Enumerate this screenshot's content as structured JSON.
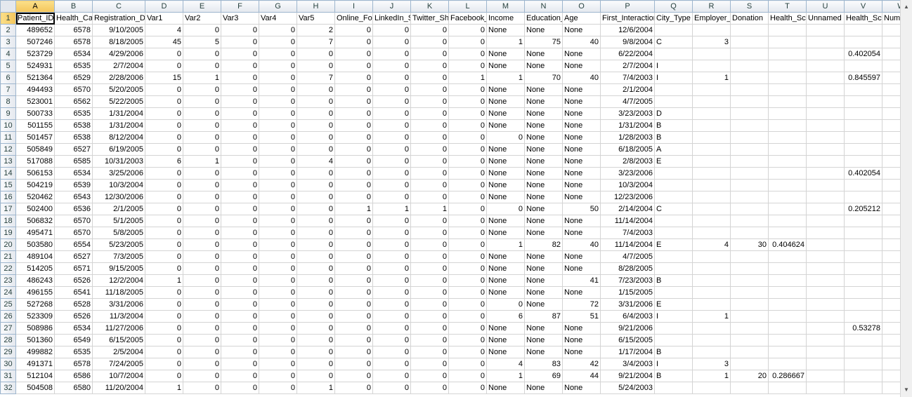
{
  "columns": [
    "A",
    "B",
    "C",
    "D",
    "E",
    "F",
    "G",
    "H",
    "I",
    "J",
    "K",
    "L",
    "M",
    "N",
    "O",
    "P",
    "Q",
    "R",
    "S",
    "T",
    "U",
    "V",
    "W"
  ],
  "header_row": [
    "Patient_ID",
    "Health_Camp_ID",
    "Registration_Date",
    "Var1",
    "Var2",
    "Var3",
    "Var4",
    "Var5",
    "Online_Follower",
    "LinkedIn_Shared",
    "Twitter_Shared",
    "Facebook_Shared",
    "Income",
    "Education_Score",
    "Age",
    "First_Interaction",
    "City_Type",
    "Employer_Category",
    "Donation",
    "Health_Score",
    "Unnamed",
    "Health_Score",
    "Number_of_stall_visited"
  ],
  "rows": [
    [
      "489652",
      "6578",
      "9/10/2005",
      "4",
      "0",
      "0",
      "0",
      "2",
      "0",
      "0",
      "0",
      "0",
      "None",
      "None",
      "None",
      "12/6/2004",
      "",
      "",
      "",
      "",
      "",
      "",
      ""
    ],
    [
      "507246",
      "6578",
      "8/18/2005",
      "45",
      "5",
      "0",
      "0",
      "7",
      "0",
      "0",
      "0",
      "0",
      "1",
      "75",
      "40",
      "9/8/2004",
      "C",
      "3",
      "",
      "",
      "",
      "",
      ""
    ],
    [
      "523729",
      "6534",
      "4/29/2006",
      "0",
      "0",
      "0",
      "0",
      "0",
      "0",
      "0",
      "0",
      "0",
      "None",
      "None",
      "None",
      "6/22/2004",
      "",
      "",
      "",
      "",
      "",
      "0.402054",
      ""
    ],
    [
      "524931",
      "6535",
      "2/7/2004",
      "0",
      "0",
      "0",
      "0",
      "0",
      "0",
      "0",
      "0",
      "0",
      "None",
      "None",
      "None",
      "2/7/2004",
      "I",
      "",
      "",
      "",
      "",
      "",
      ""
    ],
    [
      "521364",
      "6529",
      "2/28/2006",
      "15",
      "1",
      "0",
      "0",
      "7",
      "0",
      "0",
      "0",
      "1",
      "1",
      "70",
      "40",
      "7/4/2003",
      "I",
      "1",
      "",
      "",
      "",
      "0.845597",
      ""
    ],
    [
      "494493",
      "6570",
      "5/20/2005",
      "0",
      "0",
      "0",
      "0",
      "0",
      "0",
      "0",
      "0",
      "0",
      "None",
      "None",
      "None",
      "2/1/2004",
      "",
      "",
      "",
      "",
      "",
      "",
      ""
    ],
    [
      "523001",
      "6562",
      "5/22/2005",
      "0",
      "0",
      "0",
      "0",
      "0",
      "0",
      "0",
      "0",
      "0",
      "None",
      "None",
      "None",
      "4/7/2005",
      "",
      "",
      "",
      "",
      "",
      "",
      ""
    ],
    [
      "500733",
      "6535",
      "1/31/2004",
      "0",
      "0",
      "0",
      "0",
      "0",
      "0",
      "0",
      "0",
      "0",
      "None",
      "None",
      "None",
      "3/23/2003",
      "D",
      "",
      "",
      "",
      "",
      "",
      ""
    ],
    [
      "501155",
      "6538",
      "1/31/2004",
      "0",
      "0",
      "0",
      "0",
      "0",
      "0",
      "0",
      "0",
      "0",
      "None",
      "None",
      "None",
      "1/31/2004",
      "B",
      "",
      "",
      "",
      "",
      "",
      ""
    ],
    [
      "501457",
      "6538",
      "8/12/2004",
      "0",
      "0",
      "0",
      "0",
      "0",
      "0",
      "0",
      "0",
      "0",
      "0",
      "None",
      "None",
      "1/28/2003",
      "B",
      "",
      "",
      "",
      "",
      "",
      ""
    ],
    [
      "505849",
      "6527",
      "6/19/2005",
      "0",
      "0",
      "0",
      "0",
      "0",
      "0",
      "0",
      "0",
      "0",
      "None",
      "None",
      "None",
      "6/18/2005",
      "A",
      "",
      "",
      "",
      "",
      "",
      ""
    ],
    [
      "517088",
      "6585",
      "10/31/2003",
      "6",
      "1",
      "0",
      "0",
      "4",
      "0",
      "0",
      "0",
      "0",
      "None",
      "None",
      "None",
      "2/8/2003",
      "E",
      "",
      "",
      "",
      "",
      "",
      ""
    ],
    [
      "506153",
      "6534",
      "3/25/2006",
      "0",
      "0",
      "0",
      "0",
      "0",
      "0",
      "0",
      "0",
      "0",
      "None",
      "None",
      "None",
      "3/23/2006",
      "",
      "",
      "",
      "",
      "",
      "0.402054",
      ""
    ],
    [
      "504219",
      "6539",
      "10/3/2004",
      "0",
      "0",
      "0",
      "0",
      "0",
      "0",
      "0",
      "0",
      "0",
      "None",
      "None",
      "None",
      "10/3/2004",
      "",
      "",
      "",
      "",
      "",
      "",
      ""
    ],
    [
      "520462",
      "6543",
      "12/30/2006",
      "0",
      "0",
      "0",
      "0",
      "0",
      "0",
      "0",
      "0",
      "0",
      "None",
      "None",
      "None",
      "12/23/2006",
      "",
      "",
      "",
      "",
      "",
      "",
      ""
    ],
    [
      "502400",
      "6536",
      "2/1/2005",
      "0",
      "0",
      "0",
      "0",
      "0",
      "1",
      "1",
      "1",
      "0",
      "0",
      "None",
      "50",
      "2/14/2004",
      "C",
      "",
      "",
      "",
      "",
      "0.205212",
      ""
    ],
    [
      "506832",
      "6570",
      "5/1/2005",
      "0",
      "0",
      "0",
      "0",
      "0",
      "0",
      "0",
      "0",
      "0",
      "None",
      "None",
      "None",
      "11/14/2004",
      "",
      "",
      "",
      "",
      "",
      "",
      ""
    ],
    [
      "495471",
      "6570",
      "5/8/2005",
      "0",
      "0",
      "0",
      "0",
      "0",
      "0",
      "0",
      "0",
      "0",
      "None",
      "None",
      "None",
      "7/4/2003",
      "",
      "",
      "",
      "",
      "",
      "",
      ""
    ],
    [
      "503580",
      "6554",
      "5/23/2005",
      "0",
      "0",
      "0",
      "0",
      "0",
      "0",
      "0",
      "0",
      "0",
      "1",
      "82",
      "40",
      "11/14/2004",
      "E",
      "4",
      "30",
      "0.404624",
      "",
      "",
      ""
    ],
    [
      "489104",
      "6527",
      "7/3/2005",
      "0",
      "0",
      "0",
      "0",
      "0",
      "0",
      "0",
      "0",
      "0",
      "None",
      "None",
      "None",
      "4/7/2005",
      "",
      "",
      "",
      "",
      "",
      "",
      ""
    ],
    [
      "514205",
      "6571",
      "9/15/2005",
      "0",
      "0",
      "0",
      "0",
      "0",
      "0",
      "0",
      "0",
      "0",
      "None",
      "None",
      "None",
      "8/28/2005",
      "",
      "",
      "",
      "",
      "",
      "",
      ""
    ],
    [
      "486243",
      "6526",
      "12/2/2004",
      "1",
      "0",
      "0",
      "0",
      "0",
      "0",
      "0",
      "0",
      "0",
      "None",
      "None",
      "41",
      "7/23/2003",
      "B",
      "",
      "",
      "",
      "",
      "",
      ""
    ],
    [
      "496155",
      "6541",
      "11/18/2005",
      "0",
      "0",
      "0",
      "0",
      "0",
      "0",
      "0",
      "0",
      "0",
      "None",
      "None",
      "None",
      "1/15/2005",
      "",
      "",
      "",
      "",
      "",
      "",
      ""
    ],
    [
      "527268",
      "6528",
      "3/31/2006",
      "0",
      "0",
      "0",
      "0",
      "0",
      "0",
      "0",
      "0",
      "0",
      "0",
      "None",
      "72",
      "3/31/2006",
      "E",
      "",
      "",
      "",
      "",
      "",
      ""
    ],
    [
      "523309",
      "6526",
      "11/3/2004",
      "0",
      "0",
      "0",
      "0",
      "0",
      "0",
      "0",
      "0",
      "0",
      "6",
      "87",
      "51",
      "6/4/2003",
      "I",
      "1",
      "",
      "",
      "",
      "",
      ""
    ],
    [
      "508986",
      "6534",
      "11/27/2006",
      "0",
      "0",
      "0",
      "0",
      "0",
      "0",
      "0",
      "0",
      "0",
      "None",
      "None",
      "None",
      "9/21/2006",
      "",
      "",
      "",
      "",
      "",
      "0.53278",
      ""
    ],
    [
      "501360",
      "6549",
      "6/15/2005",
      "0",
      "0",
      "0",
      "0",
      "0",
      "0",
      "0",
      "0",
      "0",
      "None",
      "None",
      "None",
      "6/15/2005",
      "",
      "",
      "",
      "",
      "",
      "",
      ""
    ],
    [
      "499882",
      "6535",
      "2/5/2004",
      "0",
      "0",
      "0",
      "0",
      "0",
      "0",
      "0",
      "0",
      "0",
      "None",
      "None",
      "None",
      "1/17/2004",
      "B",
      "",
      "",
      "",
      "",
      "",
      ""
    ],
    [
      "491371",
      "6578",
      "7/24/2005",
      "0",
      "0",
      "0",
      "0",
      "0",
      "0",
      "0",
      "0",
      "0",
      "4",
      "83",
      "42",
      "3/4/2003",
      "I",
      "3",
      "",
      "",
      "",
      "",
      ""
    ],
    [
      "512104",
      "6586",
      "10/7/2004",
      "0",
      "0",
      "0",
      "0",
      "0",
      "0",
      "0",
      "0",
      "0",
      "1",
      "69",
      "44",
      "9/21/2004",
      "B",
      "1",
      "20",
      "0.286667",
      "",
      "",
      ""
    ],
    [
      "504508",
      "6580",
      "11/20/2004",
      "1",
      "0",
      "0",
      "0",
      "1",
      "0",
      "0",
      "0",
      "0",
      "None",
      "None",
      "None",
      "5/24/2003",
      "",
      "",
      "",
      "",
      "",
      "",
      ""
    ]
  ],
  "active_cell": "A1"
}
